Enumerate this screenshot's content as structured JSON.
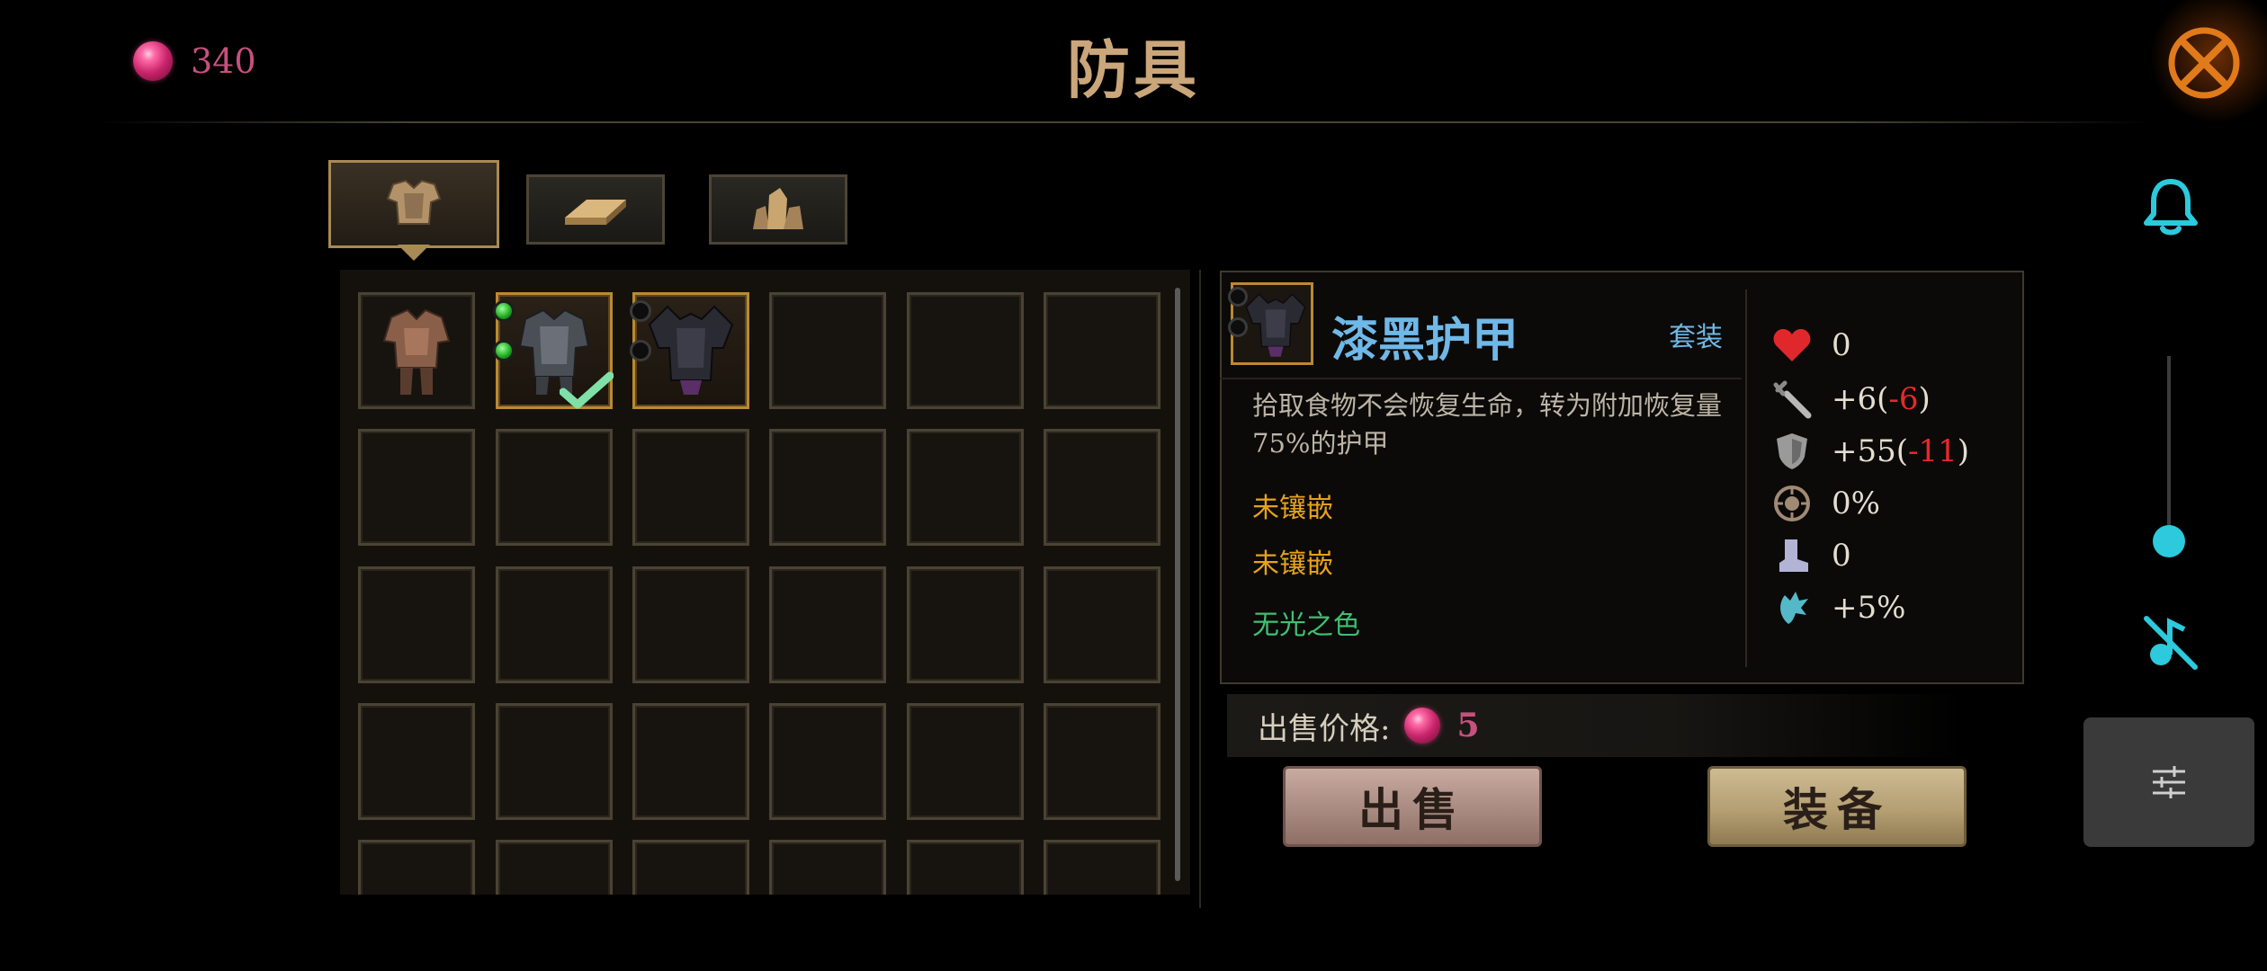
{
  "header": {
    "currency_value": "340",
    "title": "防具",
    "currency_icon": "ruby-gem-icon",
    "close_icon": "crossed-swords-circle-icon"
  },
  "tabs": [
    {
      "icon": "armor-chest-icon",
      "active": true
    },
    {
      "icon": "gold-ingot-icon",
      "active": false
    },
    {
      "icon": "crystal-ore-icon",
      "active": false
    }
  ],
  "inventory": {
    "items": [
      {
        "icon": "leather-armor-icon",
        "sockets": 0,
        "frame": "plain",
        "equipped": false
      },
      {
        "icon": "plate-armor-icon",
        "sockets": 2,
        "sockets_filled": 2,
        "frame": "gold",
        "equipped": true
      },
      {
        "icon": "dark-armor-icon",
        "sockets": 2,
        "sockets_filled": 0,
        "frame": "gold",
        "equipped": false
      }
    ],
    "columns": 6,
    "visible_rows": 5
  },
  "detail": {
    "name": "漆黑护甲",
    "set_label": "套装",
    "description": "拾取食物不会恢复生命，转为附加恢复量75%的护甲",
    "socket_1": "未镶嵌",
    "socket_2": "未镶嵌",
    "effect": "无光之色",
    "stats": [
      {
        "icon": "heart-icon",
        "value": "0",
        "diff": ""
      },
      {
        "icon": "sword-icon",
        "value": "+6(",
        "diff": "-6",
        "suffix": ")"
      },
      {
        "icon": "shield-icon",
        "value": "+55(",
        "diff": "-11",
        "suffix": ")"
      },
      {
        "icon": "crit-icon",
        "value": "0%",
        "diff": ""
      },
      {
        "icon": "boot-icon",
        "value": "0",
        "diff": ""
      },
      {
        "icon": "dodge-icon",
        "value": "+5%",
        "diff": ""
      }
    ]
  },
  "sell": {
    "label": "出售价格:",
    "value": "5"
  },
  "actions": {
    "sell_label": "出售",
    "equip_label": "装备"
  },
  "side": {
    "bell_icon": "bell-icon",
    "volume_level": 0.1,
    "mute_icon": "music-muted-icon",
    "settings_icon": "sliders-icon"
  },
  "colors": {
    "currency": "#c8507e",
    "title": "#caa67a",
    "item_name": "#6fb8e8",
    "socket_text": "#e6a21a",
    "effect_text": "#3fbf72",
    "stat_negative": "#e8282a",
    "accent_cyan": "#2dc9dc"
  }
}
